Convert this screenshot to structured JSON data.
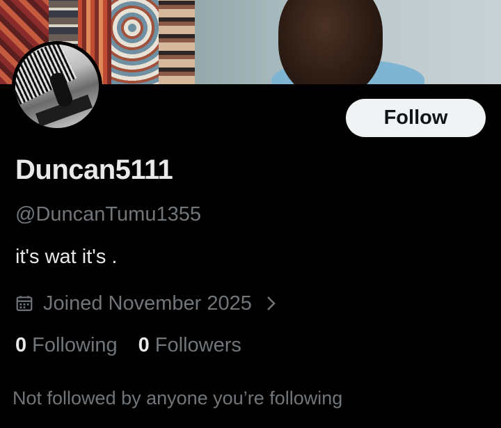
{
  "profile": {
    "display_name": "Duncan5111",
    "handle": "@DuncanTumu1355",
    "bio": "it's wat it's .",
    "joined": "Joined November 2025",
    "following_count": "0",
    "following_label": "Following",
    "followers_count": "0",
    "followers_label": "Followers",
    "not_followed_text": "Not followed by anyone you’re following"
  },
  "actions": {
    "follow_label": "Follow"
  },
  "icons": {
    "joined": "calendar-icon",
    "joined_more": "chevron-right-icon"
  },
  "colors": {
    "background": "#000000",
    "primary_text": "#e7e9ea",
    "secondary_text": "#71767b",
    "follow_button_bg": "#eff3f4"
  }
}
